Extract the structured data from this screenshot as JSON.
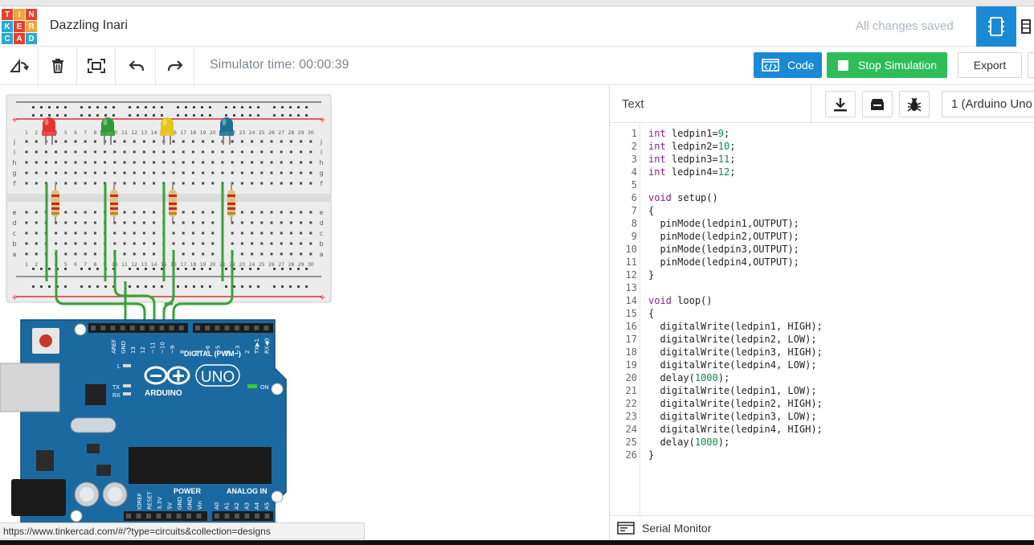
{
  "header": {
    "logo_letters": [
      "T",
      "I",
      "N",
      "K",
      "E",
      "R",
      "C",
      "A",
      "D"
    ],
    "logo_colors": [
      "#e8402c",
      "#f3a43a",
      "#e8402c",
      "#2aa8d6",
      "#e8402c",
      "#f3a43a",
      "#2aa8d6",
      "#e8402c",
      "#2aa8d6"
    ],
    "title": "Dazzling Inari",
    "save_status": "All changes saved",
    "accent": "#1a8ad6"
  },
  "toolbar": {
    "simulator_time": "Simulator time: 00:00:39",
    "code_label": "Code",
    "stop_label": "Stop Simulation",
    "export_label": "Export",
    "stop_color": "#2ebd59"
  },
  "code_panel": {
    "mode": "Text",
    "board_select": "1 (Arduino Uno",
    "serial_monitor": "Serial Monitor",
    "lines": [
      "int ledpin1=9;",
      "int ledpin2=10;",
      "int ledpin3=11;",
      "int ledpin4=12;",
      "",
      "void setup()",
      "{",
      "  pinMode(ledpin1,OUTPUT);",
      "  pinMode(ledpin2,OUTPUT);",
      "  pinMode(ledpin3,OUTPUT);",
      "  pinMode(ledpin4,OUTPUT);",
      "}",
      "",
      "void loop()",
      "{",
      "  digitalWrite(ledpin1, HIGH);",
      "  digitalWrite(ledpin2, LOW);",
      "  digitalWrite(ledpin3, HIGH);",
      "  digitalWrite(ledpin4, LOW);",
      "  delay(1000);",
      "  digitalWrite(ledpin1, LOW);",
      "  digitalWrite(ledpin2, HIGH);",
      "  digitalWrite(ledpin3, LOW);",
      "  digitalWrite(ledpin4, HIGH);",
      "  delay(1000);",
      "}"
    ]
  },
  "circuit": {
    "led_colors": [
      "#e53232",
      "#2f9a33",
      "#e8c51b",
      "#1f6f92"
    ],
    "board_name": "UNO",
    "board_brand": "ARDUINO",
    "digital_label": "DIGITAL (PWM~)",
    "power_label": "POWER",
    "analog_label": "ANALOG IN",
    "on_label": "ON",
    "tx_label": "TX",
    "rx_label": "RX",
    "l_label": "L",
    "aref_label": "AREF",
    "gnd_label": "GND",
    "digital_pins": [
      "13",
      "12",
      "~11",
      "~10",
      "~9",
      "8",
      "7",
      "~6",
      "~5",
      "4",
      "~3",
      "2",
      "TX▶1",
      "RX◀0"
    ],
    "power_pins": [
      "IOREF",
      "RESET",
      "3.3V",
      "5V",
      "GND",
      "GND",
      "Vin"
    ],
    "analog_pins": [
      "A0",
      "A1",
      "A2",
      "A3",
      "A4",
      "A5"
    ],
    "breadboard_row_labels_top": [
      "j",
      "i",
      "h",
      "g",
      "f"
    ],
    "breadboard_row_labels_bottom": [
      "e",
      "d",
      "c",
      "b",
      "a"
    ],
    "column_numbers": [
      "1",
      "2",
      "3",
      "4",
      "5",
      "6",
      "7",
      "8",
      "9",
      "10",
      "11",
      "12",
      "13",
      "14",
      "15",
      "16",
      "17",
      "18",
      "19",
      "20",
      "21",
      "22",
      "23",
      "24",
      "25",
      "26",
      "27",
      "28",
      "29",
      "30"
    ]
  },
  "status_bar": {
    "url": "https://www.tinkercad.com/#/?type=circuits&collection=designs"
  }
}
